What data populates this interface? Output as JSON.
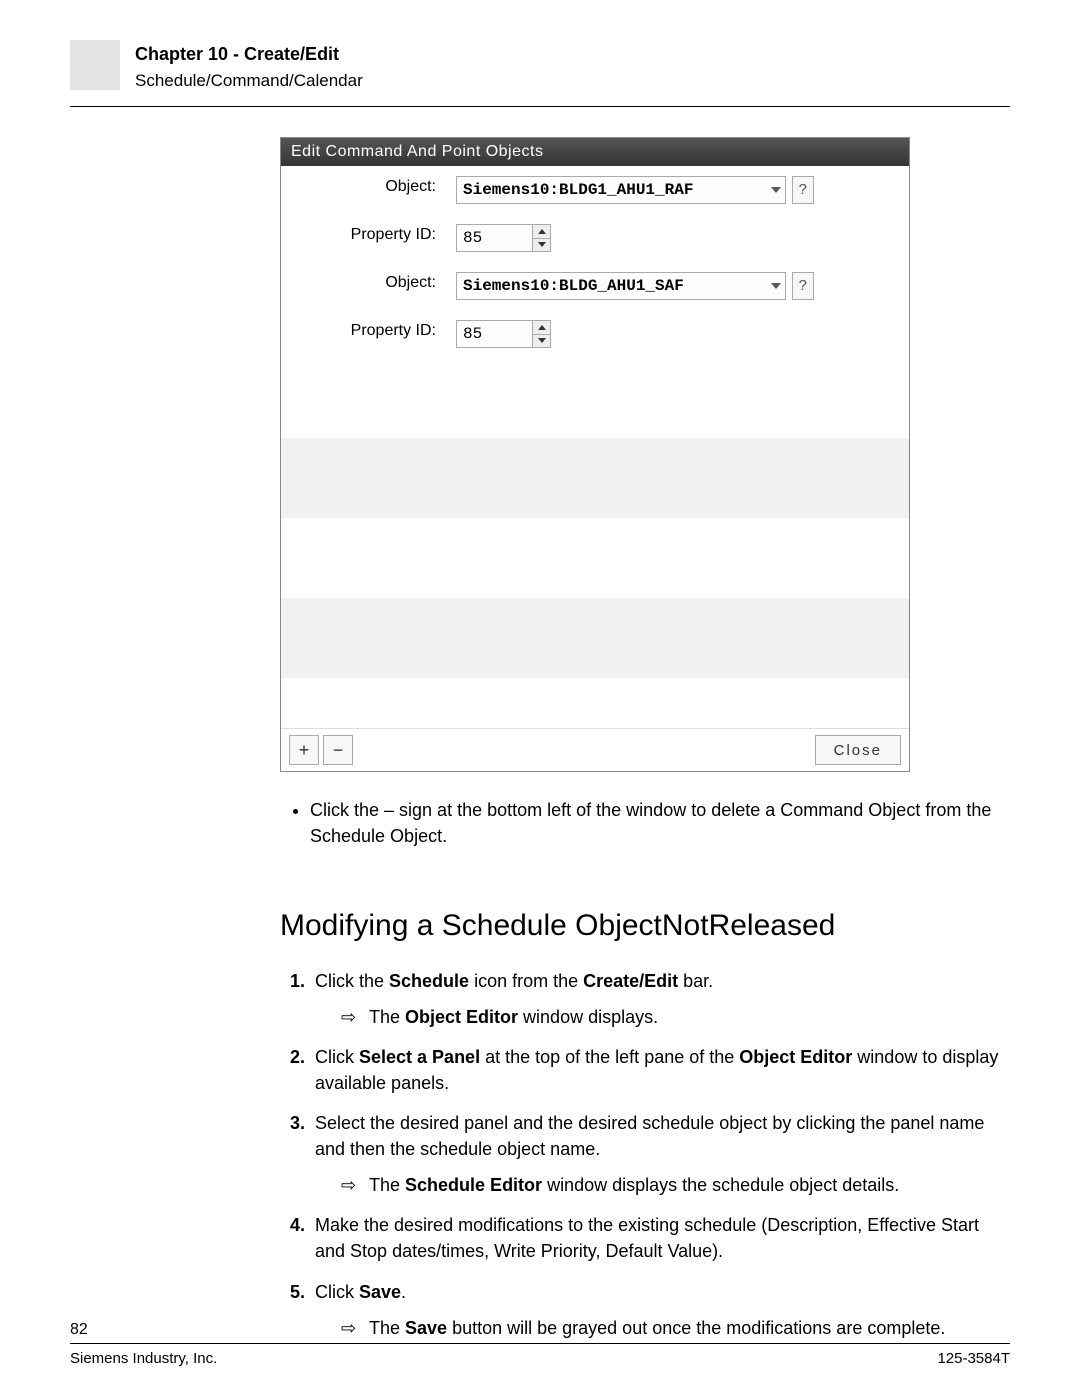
{
  "header": {
    "chapter": "Chapter 10 - Create/Edit",
    "section": "Schedule/Command/Calendar"
  },
  "window": {
    "title": "Edit Command And Point Objects",
    "rows": [
      {
        "label": "Object:",
        "type": "combo",
        "value": "Siemens10:BLDG1_AHU1_RAF"
      },
      {
        "label": "Property ID:",
        "type": "spinner",
        "value": "85"
      },
      {
        "label": "Object:",
        "type": "combo",
        "value": "Siemens10:BLDG_AHU1_SAF"
      },
      {
        "label": "Property ID:",
        "type": "spinner",
        "value": "85"
      }
    ],
    "help": "?",
    "buttons": {
      "add": "+",
      "remove": "−",
      "close": "Close"
    }
  },
  "bullet": "Click the – sign at the bottom left of the window to delete a Command Object from the Schedule Object.",
  "heading": "Modifying a Schedule ObjectNotReleased",
  "steps": {
    "s1a": "Click the ",
    "s1b": "Schedule",
    "s1c": " icon from the ",
    "s1d": "Create/Edit",
    "s1e": " bar.",
    "s1sub_a": "The ",
    "s1sub_b": "Object Editor",
    "s1sub_c": " window displays.",
    "s2a": "Click ",
    "s2b": "Select a Panel",
    "s2c": " at the top of the left pane of the ",
    "s2d": "Object Editor",
    "s2e": " window to display available panels.",
    "s3": "Select the desired panel and the desired schedule object by clicking the panel name and then the schedule object name.",
    "s3sub_a": "The ",
    "s3sub_b": "Schedule Editor",
    "s3sub_c": " window displays the schedule object details.",
    "s4": "Make the desired modifications to the existing schedule (Description, Effective Start and Stop dates/times, Write Priority, Default Value).",
    "s5a": "Click ",
    "s5b": "Save",
    "s5c": ".",
    "s5sub_a": "The ",
    "s5sub_b": "Save",
    "s5sub_c": " button will be grayed out once the modifications are complete."
  },
  "footer": {
    "page": "82",
    "company": "Siemens Industry, Inc.",
    "doc": "125-3584T"
  }
}
